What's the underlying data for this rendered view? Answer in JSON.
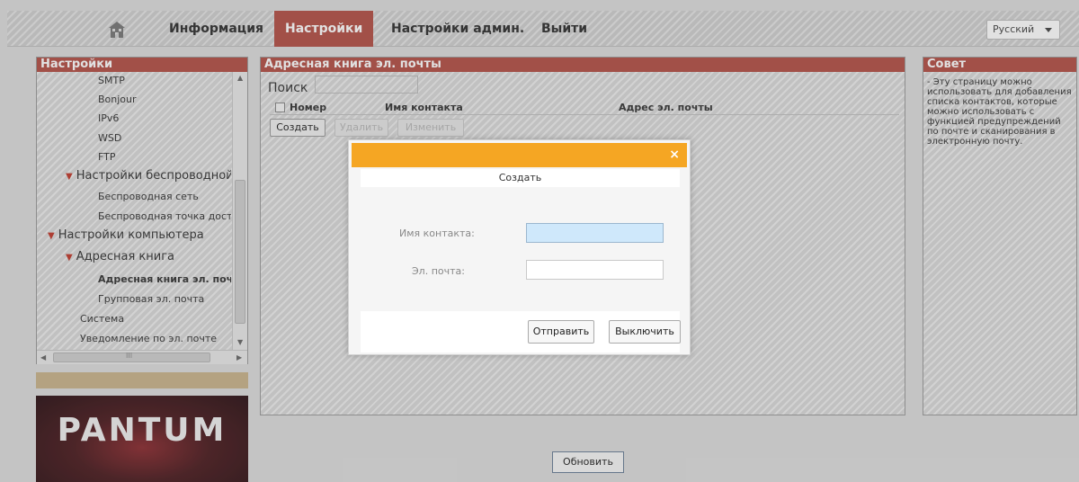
{
  "nav": {
    "home_icon": "home-icon",
    "items": [
      {
        "label": "Информация"
      },
      {
        "label": "Настройки"
      },
      {
        "label": "Настройки админ."
      },
      {
        "label": "Выйти"
      }
    ],
    "active_index": 1,
    "language": "Русский"
  },
  "left_panel": {
    "title": "Настройки",
    "tree": [
      {
        "label": "SMTP"
      },
      {
        "label": "Bonjour"
      },
      {
        "label": "IPv6"
      },
      {
        "label": "WSD"
      },
      {
        "label": "FTP"
      },
      {
        "label": "Настройки беспроводной с"
      },
      {
        "label": "Беспроводная сеть"
      },
      {
        "label": "Беспроводная точка досту"
      },
      {
        "label": "Настройки компьютера"
      },
      {
        "label": "Адресная книга"
      },
      {
        "label": "Адресная книга эл. поч"
      },
      {
        "label": "Групповая эл. почта"
      },
      {
        "label": "Система"
      },
      {
        "label": "Уведомление по эл. почте"
      }
    ],
    "scroll_grip": "III"
  },
  "logo": {
    "text": "PANTUM"
  },
  "main": {
    "title": "Адресная книга эл. почты",
    "search_label": "Поиск",
    "columns": [
      "Номер",
      "Имя контакта",
      "Адрес эл. почты"
    ],
    "buttons": {
      "create": "Создать",
      "delete": "Удалить",
      "edit": "Изменить"
    }
  },
  "tip": {
    "title": "Совет",
    "text": "- Эту страницу можно использовать для добавления списка контактов, которые можно использовать с функцией предупреждений по почте и сканирования в электронную почту."
  },
  "update_button": "Обновить",
  "dialog": {
    "title": "Создать",
    "close_glyph": "×",
    "contact_label": "Имя контакта:",
    "contact_value": "",
    "email_label": "Эл. почта:",
    "email_value": "",
    "submit": "Отправить",
    "cancel": "Выключить"
  },
  "colors": {
    "accent": "#b34f45",
    "dialog_header": "#f5a623",
    "focus_input": "#cfe8fb"
  }
}
